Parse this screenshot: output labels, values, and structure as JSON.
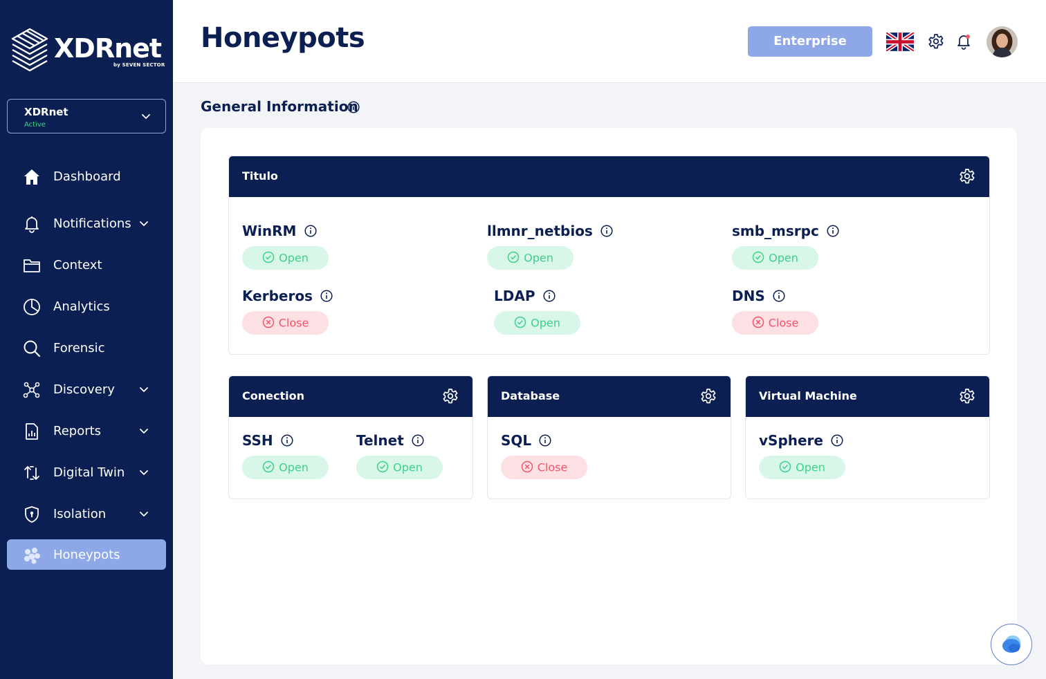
{
  "brand": {
    "logo_text": "XDRnet",
    "logo_sub": "by SEVEN SECTOR",
    "logo_icon": "stacked-layers-icon"
  },
  "org_selector": {
    "name": "XDRnet",
    "status": "Active"
  },
  "sidebar": {
    "items": [
      {
        "label": "Dashboard",
        "icon": "home-icon",
        "expandable": false,
        "active": false
      },
      {
        "label": "Notifications",
        "icon": "bell-icon",
        "expandable": true,
        "active": false
      },
      {
        "label": "Context",
        "icon": "folder-icon",
        "expandable": false,
        "active": false
      },
      {
        "label": "Analytics",
        "icon": "pie-chart-icon",
        "expandable": false,
        "active": false
      },
      {
        "label": "Forensic",
        "icon": "search-icon",
        "expandable": false,
        "active": false
      },
      {
        "label": "Discovery",
        "icon": "network-icon",
        "expandable": true,
        "active": false
      },
      {
        "label": "Reports",
        "icon": "report-icon",
        "expandable": true,
        "active": false
      },
      {
        "label": "Digital Twin",
        "icon": "sync-icon",
        "expandable": true,
        "active": false
      },
      {
        "label": "Isolation",
        "icon": "shield-icon",
        "expandable": true,
        "active": false
      },
      {
        "label": "Honeypots",
        "icon": "honeypot-icon",
        "expandable": false,
        "active": true
      }
    ]
  },
  "header": {
    "title": "Honeypots",
    "plan_button": "Enterprise",
    "language_flag": "uk-flag-icon",
    "settings_icon": "gear-icon",
    "notifications_icon": "bell-icon"
  },
  "section": {
    "title": "General Information"
  },
  "cards": {
    "titulo": {
      "title": "Titulo",
      "services": [
        {
          "name": "WinRM",
          "status": "Open"
        },
        {
          "name": "llmnr_netbios",
          "status": "Open"
        },
        {
          "name": "smb_msrpc",
          "status": "Open"
        },
        {
          "name": "Kerberos",
          "status": "Close"
        },
        {
          "name": "LDAP",
          "status": "Open"
        },
        {
          "name": "DNS",
          "status": "Close"
        }
      ]
    },
    "conection": {
      "title": "Conection",
      "services": [
        {
          "name": "SSH",
          "status": "Open"
        },
        {
          "name": "Telnet",
          "status": "Open"
        }
      ]
    },
    "database": {
      "title": "Database",
      "services": [
        {
          "name": "SQL",
          "status": "Close"
        }
      ]
    },
    "vm": {
      "title": "Virtual Machine",
      "services": [
        {
          "name": "vSphere",
          "status": "Open"
        }
      ]
    }
  },
  "colors": {
    "sidebar_bg": "#0b1f52",
    "accent": "#8ea7e6",
    "open_bg": "#d9f7e8",
    "open_text": "#3bd28a",
    "close_bg": "#fde0e3",
    "close_text": "#f0566a",
    "active_status": "#3fd38b"
  }
}
